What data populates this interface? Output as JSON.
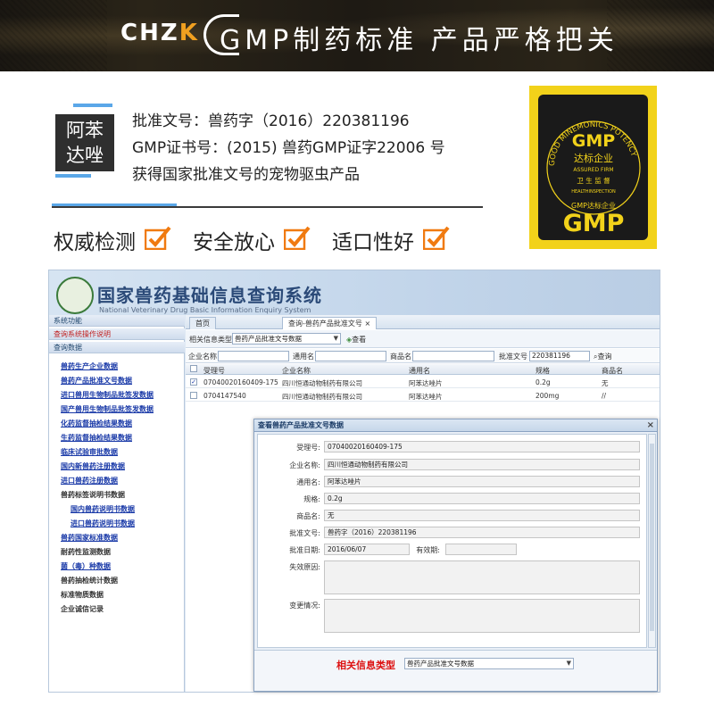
{
  "banner": {
    "brand_main": "CHZ",
    "brand_accent": "K",
    "title": "GMP制药标准 产品严格把关"
  },
  "product": {
    "name_line1": "阿苯",
    "name_line2": "达唑",
    "approval_no": "批准文号：兽药字（2016）220381196",
    "gmp_cert": "GMP证书号：(2015) 兽药GMP证字22006 号",
    "note": "获得国家批准文号的宠物驱虫产品"
  },
  "features": [
    "权威检测",
    "安全放心",
    "适口性好"
  ],
  "badge": {
    "arc_text": "GOOD MINEMONICS POTENCY",
    "big": "GMP",
    "cn1": "达标企业",
    "en1": "ASSURED FIRM",
    "cn2": "卫 生 监 督",
    "en2": "HEALTHINSPECTION",
    "cn3": "GMP达标企业",
    "big2": "GMP"
  },
  "screenshot": {
    "system_title": "国家兽药基础信息查询系统",
    "system_en": "National Veterinary Drug Basic Information Enquiry System",
    "sidebar": {
      "bar_functions": "系统功能",
      "bar_help": "查询系统操作说明",
      "bar_data": "查询数据",
      "items": [
        {
          "label": "兽药生产企业数据",
          "kind": "link"
        },
        {
          "label": "兽药产品批准文号数据",
          "kind": "link"
        },
        {
          "label": "进口兽用生物制品批签发数据",
          "kind": "link"
        },
        {
          "label": "国产兽用生物制品批签发数据",
          "kind": "link"
        },
        {
          "label": "化药监督抽检结果数据",
          "kind": "link"
        },
        {
          "label": "生药监督抽检结果数据",
          "kind": "link"
        },
        {
          "label": "临床试验审批数据",
          "kind": "link"
        },
        {
          "label": "国内新兽药注册数据",
          "kind": "link"
        },
        {
          "label": "进口兽药注册数据",
          "kind": "link"
        },
        {
          "label": "兽药标签说明书数据",
          "kind": "plain"
        },
        {
          "label": "国内兽药说明书数据",
          "kind": "sub"
        },
        {
          "label": "进口兽药说明书数据",
          "kind": "sub"
        },
        {
          "label": "兽药国家标准数据",
          "kind": "link"
        },
        {
          "label": "耐药性监测数据",
          "kind": "plain"
        },
        {
          "label": "菌（毒）种数据",
          "kind": "link"
        },
        {
          "label": "兽药抽检统计数据",
          "kind": "plain"
        },
        {
          "label": "标准物质数据",
          "kind": "plain"
        },
        {
          "label": "企业诚信记录",
          "kind": "plain"
        }
      ]
    },
    "tabs": {
      "home": "首页",
      "active": "查询-兽药产品批准文号"
    },
    "toolbar": {
      "label": "相关信息类型",
      "select": "兽药产品批准文号数据",
      "query": "查看"
    },
    "filter": {
      "company_label": "企业名称",
      "common_label": "通用名",
      "trade_label": "商品名",
      "approval_label": "批准文号",
      "approval_value": "220381196",
      "query": "查询"
    },
    "grid": {
      "headers": [
        "受理号",
        "企业名称",
        "通用名",
        "规格",
        "商品名"
      ],
      "rows": [
        {
          "checked": true,
          "no": "07040020160409-175",
          "company": "四川恒通动物制药有限公司",
          "common": "阿苯达唑片",
          "spec": "0.2g",
          "trade": "无"
        },
        {
          "checked": false,
          "no": "0704147540",
          "company": "四川恒通动物制药有限公司",
          "common": "阿苯达唑片",
          "spec": "200mg",
          "trade": "//"
        }
      ]
    },
    "dialog": {
      "title": "查看兽药产品批准文号数据",
      "fields": {
        "accept_label": "受理号:",
        "accept_value": "07040020160409-175",
        "company_label": "企业名称:",
        "company_value": "四川恒通动物制药有限公司",
        "common_label": "通用名:",
        "common_value": "阿苯达唑片",
        "spec_label": "规格:",
        "spec_value": "0.2g",
        "trade_label": "商品名:",
        "trade_value": "无",
        "approval_label": "批准文号:",
        "approval_value": "兽药字（2016）220381196",
        "date_label": "批准日期:",
        "date_value": "2016/06/07",
        "valid_label": "有效期:",
        "valid_value": "",
        "invalid_label": "失效原因:",
        "change_label": "变更情况:"
      },
      "footer_label": "相关信息类型",
      "footer_select": "兽药产品批准文号数据"
    }
  },
  "colors": {
    "accent_blue": "#5aa7e8",
    "check_orange": "#f07a10",
    "badge_yellow": "#f2d21a",
    "link_blue": "#1a3aa8",
    "footer_red": "#dd1111"
  }
}
